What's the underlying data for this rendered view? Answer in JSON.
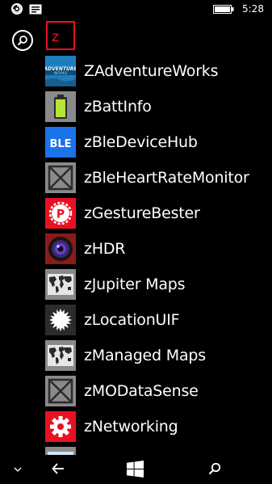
{
  "status_bar": {
    "time": "5:28",
    "icons": [
      "sync-icon",
      "message-icon",
      "battery-icon"
    ]
  },
  "search": {
    "icon": "search-icon"
  },
  "jump_letter": {
    "label": "z"
  },
  "apps": [
    {
      "label": "ZAdventureWorks",
      "icon": "adventure-works-icon",
      "tile_color": "#1e7ebd"
    },
    {
      "label": "zBattInfo",
      "icon": "battery-info-icon",
      "tile_color": "#8a8a8a"
    },
    {
      "label": "zBleDeviceHub",
      "icon": "ble-device-hub-icon",
      "tile_color": "#1a73e8",
      "tile_text": "BLE"
    },
    {
      "label": "zBleHeartRateMonitor",
      "icon": "placeholder-app-icon",
      "tile_color": "#8a8a8a"
    },
    {
      "label": "zGestureBester",
      "icon": "gesture-bester-icon",
      "tile_color": "#e81123"
    },
    {
      "label": "zHDR",
      "icon": "hdr-camera-icon",
      "tile_color": "#8b1a1a"
    },
    {
      "label": "zJupiter Maps",
      "icon": "world-map-icon",
      "tile_color": "#8a8a8a"
    },
    {
      "label": "zLocationUIF",
      "icon": "location-sun-icon",
      "tile_color": "#2b2b2b"
    },
    {
      "label": "zManaged Maps",
      "icon": "world-map-icon",
      "tile_color": "#8a8a8a"
    },
    {
      "label": "zMODataSense",
      "icon": "placeholder-app-icon",
      "tile_color": "#8a8a8a"
    },
    {
      "label": "zNetworking",
      "icon": "gear-icon",
      "tile_color": "#e81123"
    }
  ],
  "nav_bar": {
    "items": [
      {
        "name": "expand-chevron-icon"
      },
      {
        "name": "back-arrow-icon"
      },
      {
        "name": "windows-start-icon"
      },
      {
        "name": "search-icon"
      }
    ]
  }
}
